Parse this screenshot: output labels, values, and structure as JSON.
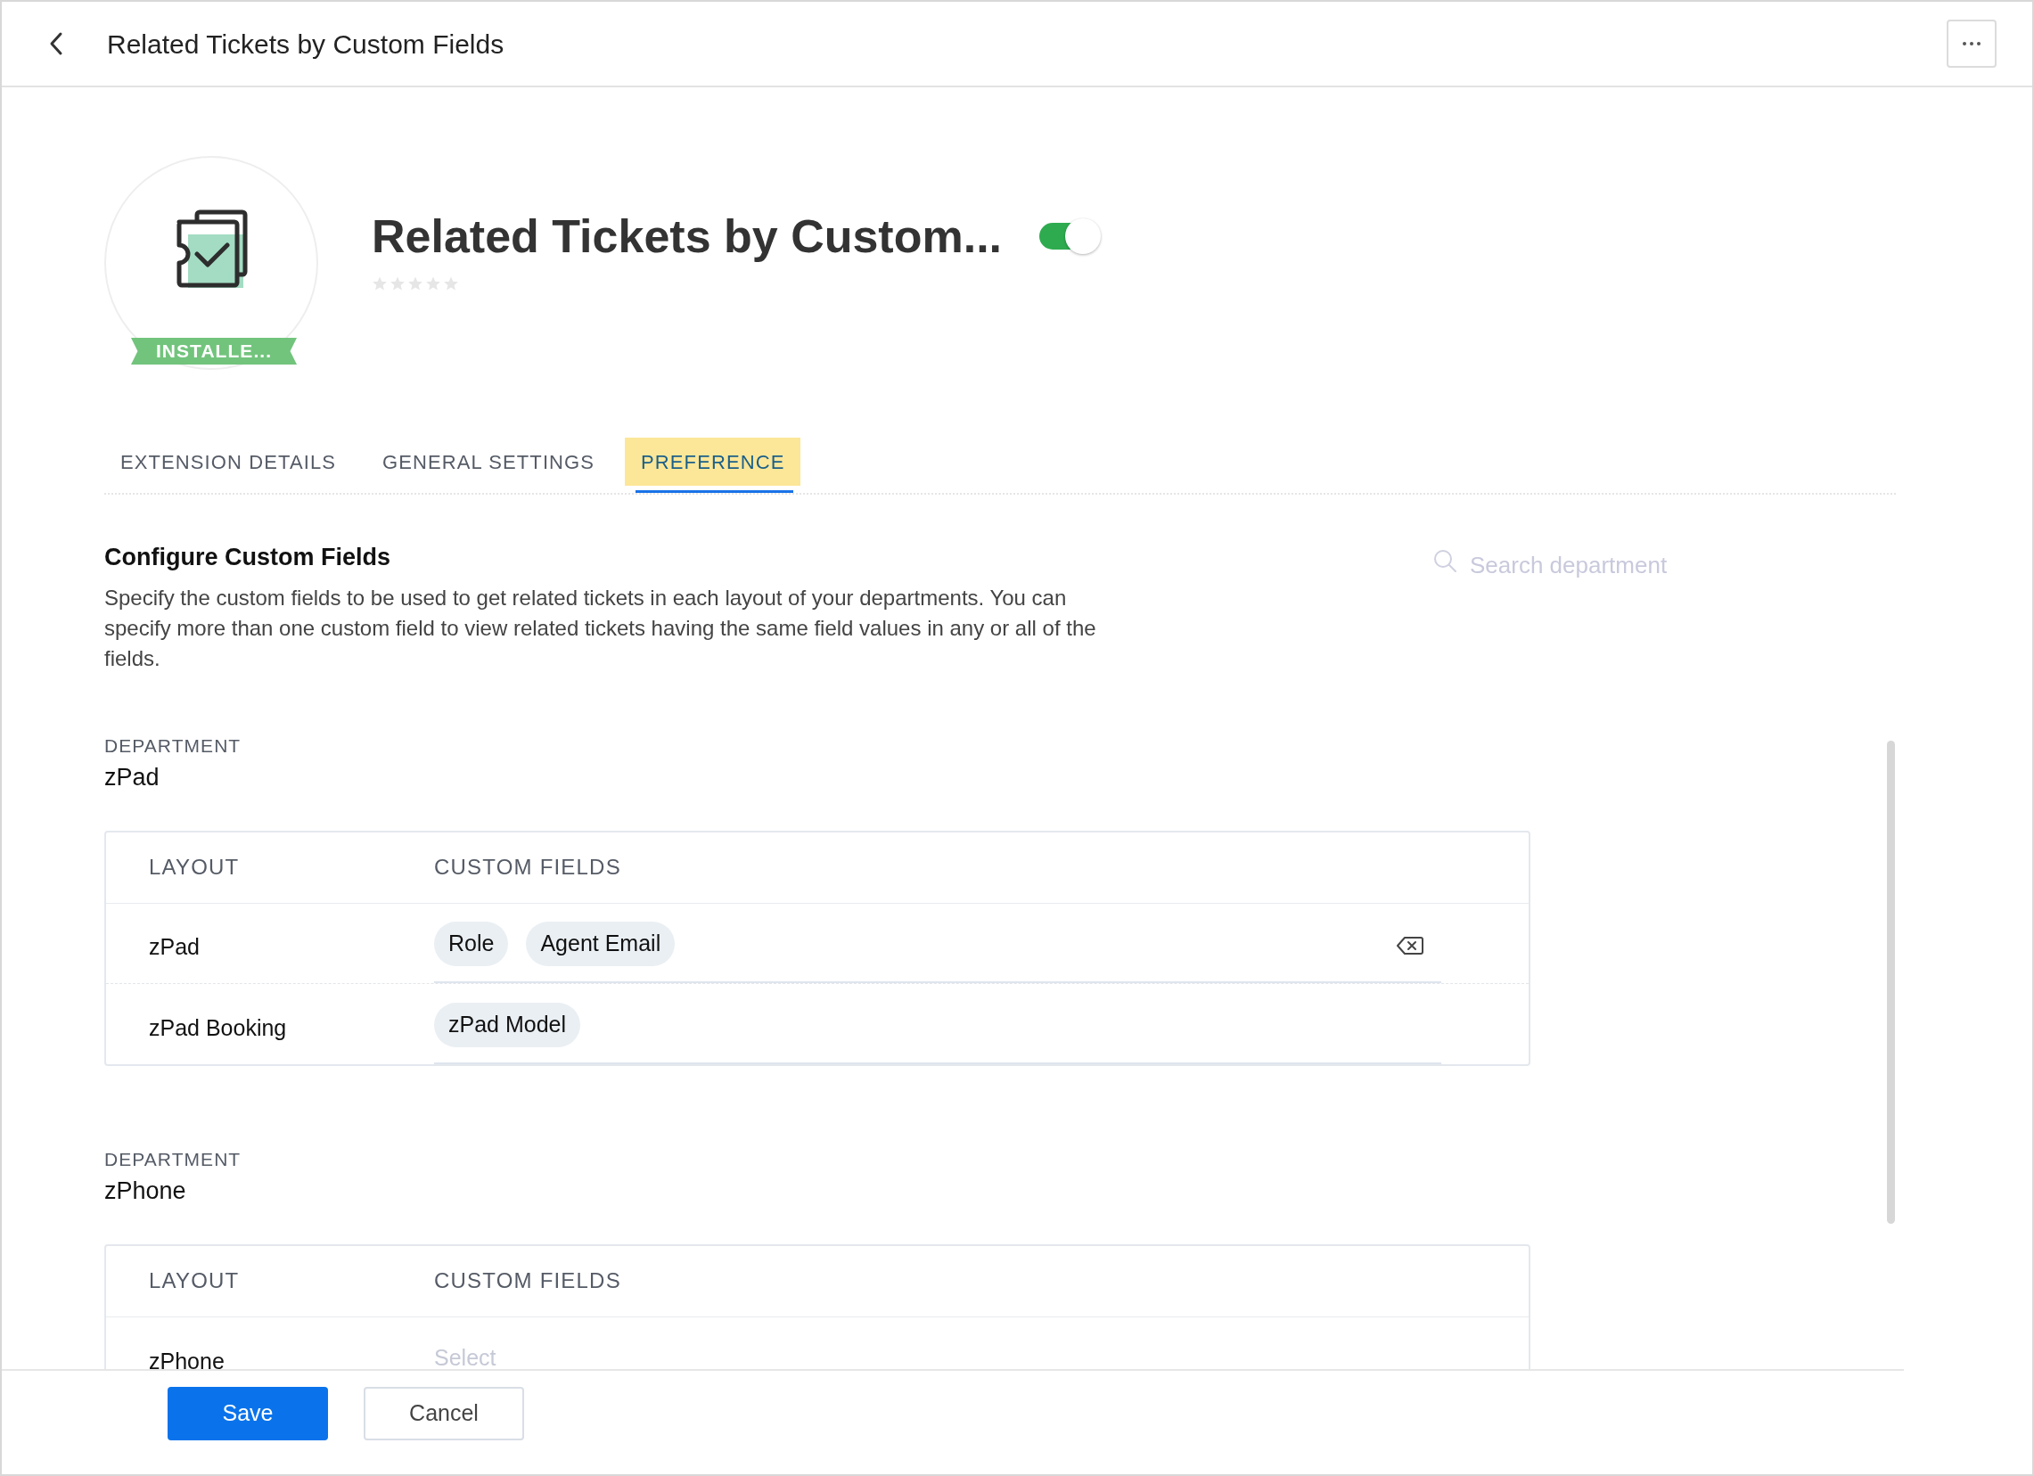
{
  "header": {
    "title": "Related Tickets by Custom Fields"
  },
  "extension": {
    "name": "Related Tickets by Custom...",
    "badge": "INSTALLE...",
    "enabled": true,
    "stars": 0
  },
  "tabs": [
    {
      "label": "EXTENSION DETAILS",
      "selected": false
    },
    {
      "label": "GENERAL SETTINGS",
      "selected": false
    },
    {
      "label": "PREFERENCE",
      "selected": true
    }
  ],
  "section": {
    "title": "Configure Custom Fields",
    "description": "Specify the custom fields to be used to get related tickets in each layout of your departments. You can specify more than one custom field to view related tickets having the same field values in any or all of the fields.",
    "search": {
      "placeholder": "Search department"
    }
  },
  "departments": [
    {
      "label": "DEPARTMENT",
      "name": "zPad",
      "columns": [
        "LAYOUT",
        "CUSTOM FIELDS"
      ],
      "rows": [
        {
          "layout": "zPad",
          "fields": [
            "Role",
            "Agent Email"
          ],
          "clearable": true
        },
        {
          "layout": "zPad Booking",
          "fields": [
            "zPad Model"
          ],
          "clearable": false
        }
      ]
    },
    {
      "label": "DEPARTMENT",
      "name": "zPhone",
      "columns": [
        "LAYOUT",
        "CUSTOM FIELDS"
      ],
      "rows": [
        {
          "layout": "zPhone",
          "fields": [],
          "placeholder": "Select",
          "clearable": false
        }
      ]
    }
  ],
  "buttons": [
    {
      "label": "Save",
      "kind": "primary"
    },
    {
      "label": "Cancel",
      "kind": "secondary"
    }
  ]
}
